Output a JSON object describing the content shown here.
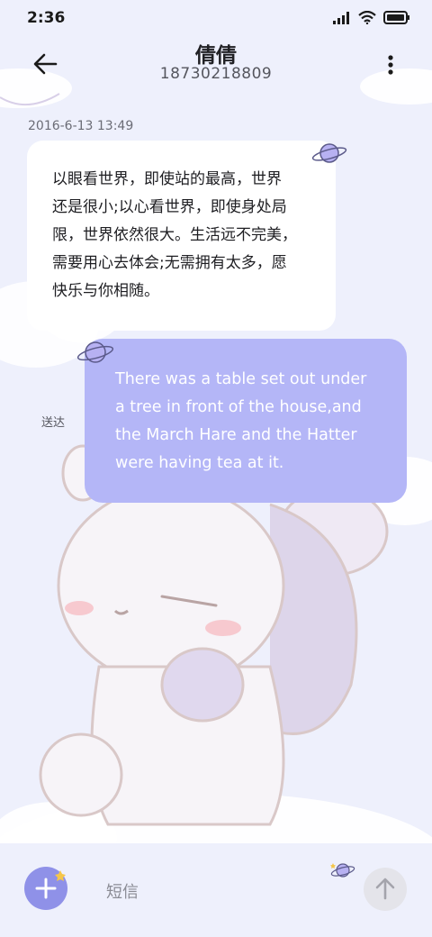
{
  "status_bar": {
    "time": "2:36",
    "icons": [
      "signal-icon",
      "wifi-icon",
      "battery-icon"
    ]
  },
  "header": {
    "contact_name": "倩倩",
    "contact_number": "18730218809",
    "back_icon": "arrow-left-icon",
    "more_icon": "more-vertical-icon"
  },
  "conversation": {
    "timestamp": "2016-6-13 13:49",
    "incoming_message": {
      "lines": [
        "以眼看世界，即使站的最高，世界",
        "还是很小;以心看世界，即使身处局",
        "限，世界依然很大。生活远不完美，",
        "需要用心去体会;无需拥有太多，愿",
        "快乐与你相随。"
      ]
    },
    "outgoing_message": {
      "lines": [
        "There was a table set out under",
        "a tree in front of the house,and",
        "the March Hare and the Hatter",
        "were having tea at it."
      ],
      "status": "送达"
    }
  },
  "composer": {
    "placeholder": "短信",
    "add_icon": "plus-icon",
    "send_icon": "arrow-up-icon"
  },
  "colors": {
    "background": "#eef0fc",
    "incoming_bubble": "#ffffff",
    "outgoing_bubble": "#b4b6f7",
    "accent": "#8f91e8"
  }
}
